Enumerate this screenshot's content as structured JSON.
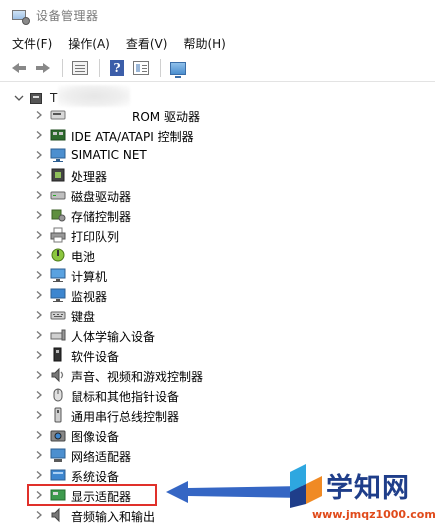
{
  "window": {
    "title": "设备管理器"
  },
  "menu": [
    {
      "id": "file",
      "label": "文件(F)"
    },
    {
      "id": "action",
      "label": "操作(A)"
    },
    {
      "id": "view",
      "label": "查看(V)"
    },
    {
      "id": "help",
      "label": "帮助(H)"
    }
  ],
  "toolbar": {
    "buttons": [
      "back-icon",
      "forward-icon",
      "properties-icon",
      "help-icon",
      "view-icon",
      "monitor-icon"
    ]
  },
  "tree": {
    "root_label": "T",
    "items": [
      {
        "label": "ROM 驱动器",
        "icon": "dvd-drive-icon"
      },
      {
        "label": "IDE ATA/ATAPI 控制器",
        "icon": "ide-controller-icon"
      },
      {
        "label": "SIMATIC NET",
        "icon": "network-monitor-icon"
      },
      {
        "label": "处理器",
        "icon": "processor-icon"
      },
      {
        "label": "磁盘驱动器",
        "icon": "disk-drive-icon"
      },
      {
        "label": "存储控制器",
        "icon": "storage-controller-icon"
      },
      {
        "label": "打印队列",
        "icon": "printer-icon"
      },
      {
        "label": "电池",
        "icon": "battery-icon"
      },
      {
        "label": "计算机",
        "icon": "computer-icon"
      },
      {
        "label": "监视器",
        "icon": "monitor-icon"
      },
      {
        "label": "键盘",
        "icon": "keyboard-icon"
      },
      {
        "label": "人体学输入设备",
        "icon": "hid-icon"
      },
      {
        "label": "软件设备",
        "icon": "software-device-icon"
      },
      {
        "label": "声音、视频和游戏控制器",
        "icon": "sound-icon"
      },
      {
        "label": "鼠标和其他指针设备",
        "icon": "mouse-icon"
      },
      {
        "label": "通用串行总线控制器",
        "icon": "usb-icon"
      },
      {
        "label": "图像设备",
        "icon": "camera-icon"
      },
      {
        "label": "网络适配器",
        "icon": "network-adapter-icon"
      },
      {
        "label": "系统设备",
        "icon": "system-device-icon"
      },
      {
        "label": "显示适配器",
        "icon": "display-adapter-icon"
      },
      {
        "label": "音频输入和输出",
        "icon": "audio-io-icon"
      }
    ],
    "highlighted_item": "显示适配器"
  },
  "watermark": {
    "text": "学知网",
    "url": "www.jmqz1000.com"
  },
  "colors": {
    "highlight": "#e0302a",
    "arrow": "#3566c4",
    "watermark_text": "#1f3e8a",
    "watermark_url": "#e04a1a"
  }
}
